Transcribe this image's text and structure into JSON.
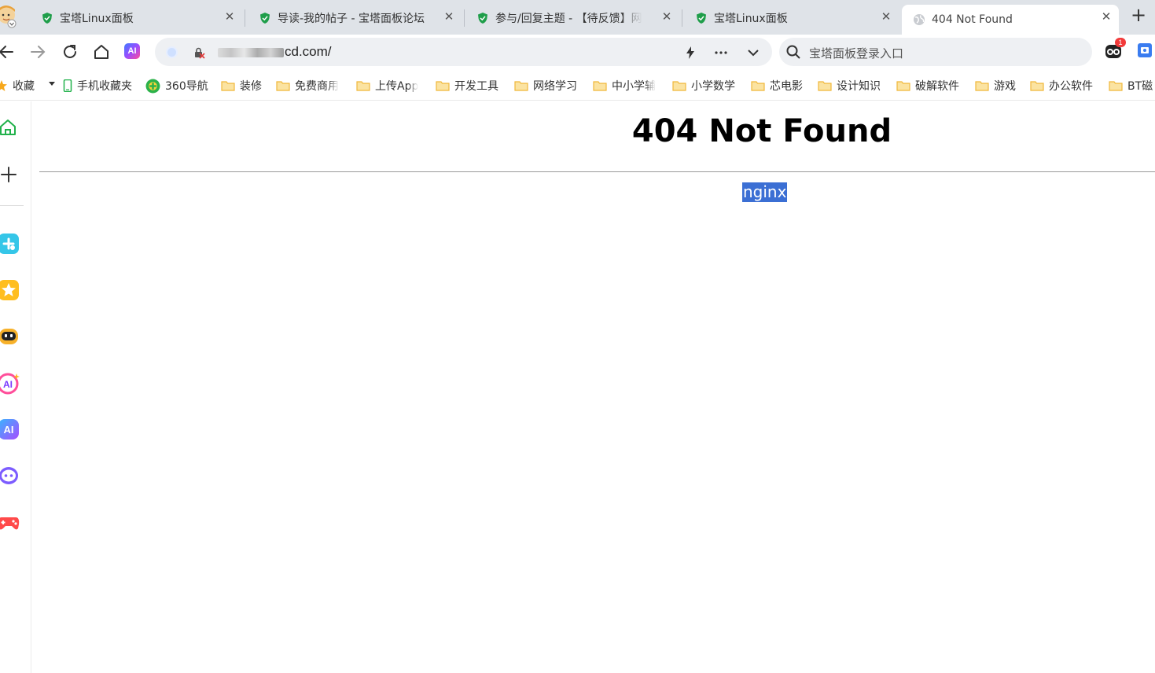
{
  "browser": {
    "tabs": [
      {
        "title": "宝塔Linux面板",
        "icon": "baota-shield-icon",
        "active": false
      },
      {
        "title": "导读-我的帖子 - 宝塔面板论坛",
        "icon": "baota-shield-icon",
        "active": false
      },
      {
        "title": "参与/回复主题 - 【待反馈】网",
        "icon": "baota-shield-icon",
        "active": false
      },
      {
        "title": "宝塔Linux面板",
        "icon": "baota-shield-icon",
        "active": false
      },
      {
        "title": "404 Not Found",
        "icon": "globe-icon",
        "active": true
      }
    ],
    "tab_close_glyph": "✕",
    "new_tab_glyph": "+",
    "toolbar": {
      "ai_label": "AI",
      "url_visible": "cd.com/",
      "search_placeholder": "宝塔面板登录入口",
      "extension_badge": "1"
    },
    "bookmarks": [
      {
        "label": "收藏",
        "icon": "star-icon"
      },
      {
        "label": "手机收藏夹",
        "icon": "phone-icon"
      },
      {
        "label": "360导航",
        "icon": "navigation-360-icon"
      },
      {
        "label": "装修",
        "icon": "folder-icon"
      },
      {
        "label": "免费商用",
        "icon": "folder-icon"
      },
      {
        "label": "上传App",
        "icon": "folder-icon"
      },
      {
        "label": "开发工具",
        "icon": "folder-icon"
      },
      {
        "label": "网络学习",
        "icon": "folder-icon"
      },
      {
        "label": "中小学辅",
        "icon": "folder-icon"
      },
      {
        "label": "小学数学",
        "icon": "folder-icon"
      },
      {
        "label": "芯电影",
        "icon": "folder-icon"
      },
      {
        "label": "设计知识",
        "icon": "folder-icon"
      },
      {
        "label": "破解软件",
        "icon": "folder-icon"
      },
      {
        "label": "游戏",
        "icon": "folder-icon"
      },
      {
        "label": "办公软件",
        "icon": "folder-icon"
      },
      {
        "label": "BT磁",
        "icon": "folder-icon"
      }
    ],
    "sidebar_icons": [
      "home-icon",
      "add-icon",
      "app-store-icon",
      "favorites-star-icon",
      "chatbot-icon",
      "ai-assistant-icon",
      "ai-writer-icon",
      "chat-bubble-icon",
      "game-controller-icon"
    ]
  },
  "page": {
    "heading": "404 Not Found",
    "server": "nginx"
  },
  "colors": {
    "tabbar_bg": "#dfe3e8",
    "selection": "#3b6fd4",
    "folder": "#f7c85a",
    "shield": "#1f9e4a"
  }
}
